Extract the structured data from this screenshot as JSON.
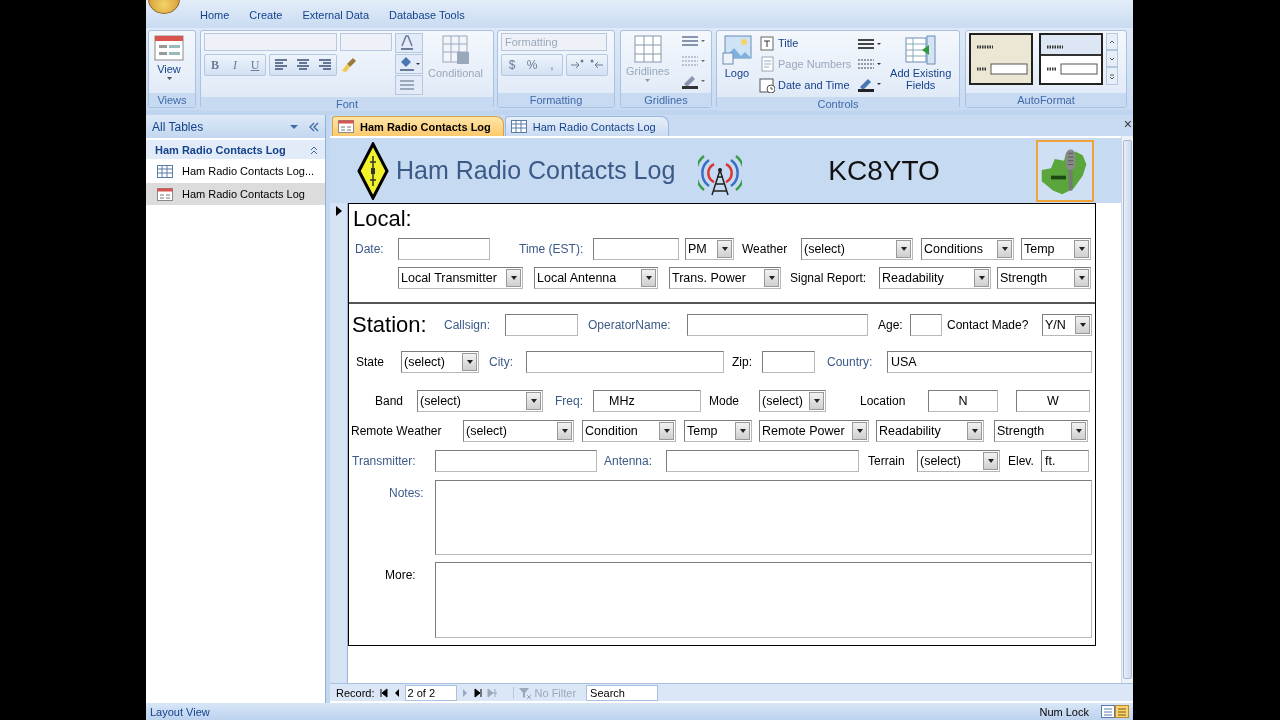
{
  "ribbon": {
    "tabs": [
      "Home",
      "Create",
      "External Data",
      "Database Tools"
    ],
    "groups": [
      {
        "kind": "views",
        "label": "Views",
        "button": "View"
      },
      {
        "kind": "font",
        "label": "Font",
        "style_buttons": [
          "B",
          "I",
          "U"
        ],
        "conditional": {
          "label": "Conditional",
          "disabled": true
        }
      },
      {
        "kind": "formatting",
        "label": "Formatting",
        "format_box": {
          "placeholder": "Formatting",
          "disabled": true
        },
        "number_buttons": [
          "$",
          "%",
          ","
        ]
      },
      {
        "kind": "gridlines",
        "label": "Gridlines",
        "button": {
          "label": "Gridlines",
          "disabled": true
        }
      },
      {
        "kind": "controls",
        "label": "Controls",
        "logo": "Logo",
        "items": [
          {
            "label": "Title",
            "disabled": false
          },
          {
            "label": "Page Numbers",
            "disabled": true
          },
          {
            "label": "Date and Time",
            "disabled": false
          }
        ],
        "add_fields": "Add Existing Fields"
      },
      {
        "kind": "autoformat",
        "label": "AutoFormat"
      }
    ]
  },
  "navigation": {
    "header": "All Tables",
    "groups": [
      {
        "title": "Ham Radio Contacts Log",
        "expanded": true,
        "items": [
          {
            "kind": "table",
            "label": "Ham Radio Contacts Log...",
            "selected": false
          },
          {
            "kind": "form",
            "label": "Ham Radio Contacts Log",
            "selected": true
          }
        ]
      }
    ]
  },
  "document_tabs": [
    {
      "kind": "form",
      "label": "Ham Radio Contacts Log",
      "selected": true
    },
    {
      "kind": "table",
      "label": "Ham Radio Contacts Log",
      "selected": false
    }
  ],
  "close": "×",
  "form": {
    "title": "Ham Radio Contacts Log",
    "callsign": "KC8YTO",
    "sections": [
      {
        "rows": [
          {
            "items": [
              {
                "kind": "heading",
                "text": "Local:"
              }
            ]
          },
          {
            "items": [
              {
                "kind": "label",
                "text": "Date:",
                "color": "#3b5a87"
              },
              {
                "kind": "text"
              },
              {
                "kind": "label",
                "text": "Time (EST):",
                "color": "#3b5a87"
              },
              {
                "kind": "text"
              },
              {
                "kind": "combo",
                "value": "PM"
              },
              {
                "kind": "label",
                "text": "Weather",
                "color": "#000000"
              },
              {
                "kind": "combo",
                "value": "(select)"
              },
              {
                "kind": "combo",
                "value": "Conditions"
              },
              {
                "kind": "combo",
                "value": "Temp"
              }
            ]
          },
          {
            "items": [
              {
                "kind": "combo",
                "value": "Local Transmitter"
              },
              {
                "kind": "combo",
                "value": "Local Antenna"
              },
              {
                "kind": "combo",
                "value": "Trans. Power"
              },
              {
                "kind": "label",
                "text": "Signal Report:",
                "color": "#000000"
              },
              {
                "kind": "combo",
                "value": "Readability"
              },
              {
                "kind": "combo",
                "value": "Strength"
              }
            ]
          }
        ]
      },
      {
        "rows": [
          {
            "items": [
              {
                "kind": "heading",
                "text": "Station:"
              },
              {
                "kind": "label",
                "text": "Callsign:",
                "color": "#3b5a87"
              },
              {
                "kind": "text"
              },
              {
                "kind": "label",
                "text": "OperatorName:",
                "color": "#3b5a87"
              },
              {
                "kind": "text"
              },
              {
                "kind": "label",
                "text": "Age:",
                "color": "#000000"
              },
              {
                "kind": "text"
              },
              {
                "kind": "label",
                "text": "Contact Made?",
                "color": "#000000"
              },
              {
                "kind": "combo",
                "value": "Y/N"
              }
            ]
          },
          {
            "items": [
              {
                "kind": "label",
                "text": "State",
                "color": "#000000"
              },
              {
                "kind": "combo",
                "value": "(select)"
              },
              {
                "kind": "label",
                "text": "City:",
                "color": "#3b5a87"
              },
              {
                "kind": "text"
              },
              {
                "kind": "label",
                "text": "Zip:",
                "color": "#000000"
              },
              {
                "kind": "text"
              },
              {
                "kind": "label",
                "text": "Country:",
                "color": "#3b5a87"
              },
              {
                "kind": "text",
                "value": "USA"
              }
            ]
          },
          {
            "items": [
              {
                "kind": "label",
                "text": "Band",
                "color": "#000000"
              },
              {
                "kind": "combo",
                "value": "(select)"
              },
              {
                "kind": "label",
                "text": "Freq:",
                "color": "#3b5a87"
              },
              {
                "kind": "text",
                "value": "MHz"
              },
              {
                "kind": "label",
                "text": "Mode",
                "color": "#000000"
              },
              {
                "kind": "combo",
                "value": "(select)"
              },
              {
                "kind": "label",
                "text": "Location",
                "color": "#000000"
              },
              {
                "kind": "text",
                "value": "N"
              },
              {
                "kind": "text",
                "value": "W"
              }
            ]
          },
          {
            "items": [
              {
                "kind": "label",
                "text": "Remote Weather",
                "color": "#000000"
              },
              {
                "kind": "combo",
                "value": "(select)"
              },
              {
                "kind": "combo",
                "value": "Condition"
              },
              {
                "kind": "combo",
                "value": "Temp"
              },
              {
                "kind": "combo",
                "value": "Remote Power"
              },
              {
                "kind": "combo",
                "value": "Readability"
              },
              {
                "kind": "combo",
                "value": "Strength"
              }
            ]
          },
          {
            "items": [
              {
                "kind": "label",
                "text": "Transmitter:",
                "color": "#3b5a87"
              },
              {
                "kind": "text"
              },
              {
                "kind": "label",
                "text": "Antenna:",
                "color": "#3b5a87"
              },
              {
                "kind": "text"
              },
              {
                "kind": "label",
                "text": "Terrain",
                "color": "#000000"
              },
              {
                "kind": "combo",
                "value": "(select)"
              },
              {
                "kind": "label",
                "text": "Elev.",
                "color": "#000000"
              },
              {
                "kind": "text",
                "value": "ft."
              }
            ]
          }
        ]
      }
    ],
    "memos": [
      {
        "label": "Notes:",
        "color": "#3b5a87"
      },
      {
        "label": "More:",
        "color": "#000000"
      }
    ]
  },
  "record_navigator": {
    "label": "Record:",
    "position": "2 of 2",
    "filter": {
      "label": "No Filter",
      "disabled": true
    },
    "search": {
      "placeholder": "Search"
    }
  },
  "status_bar": {
    "mode": "Layout View",
    "indicator": "Num Lock"
  }
}
